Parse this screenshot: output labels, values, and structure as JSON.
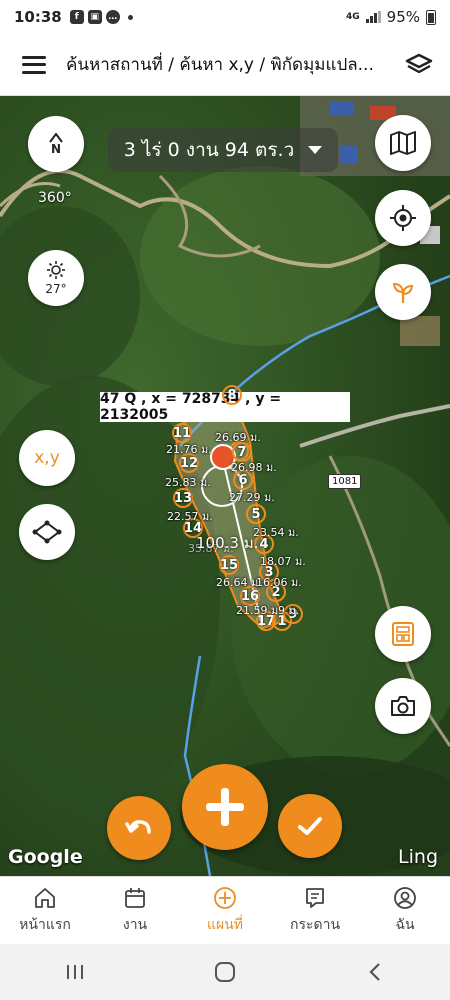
{
  "status_bar": {
    "time": "10:38",
    "network": "4G",
    "battery": "95%",
    "notification_apps": [
      "facebook-icon",
      "gallery-icon",
      "line-icon"
    ]
  },
  "header": {
    "title": "ค้นหาสถานที่ / ค้นหา x,y / พิกัดมุมแปล..."
  },
  "map": {
    "area_text": "3 ไร่ 0 งาน 94 ตร.ว",
    "compass_label": "N",
    "compass_angle": "360°",
    "temperature": "27°",
    "xy_button": "x,y",
    "coordinate": "47 Q , x = 728734 , y = 2132005",
    "road_number": "1081",
    "plot_area_label": "100.3 ม.",
    "segment_labels": [
      "21.76 ม.",
      "26.69 ม.",
      "26.98 ม.",
      "25.83 ม.",
      "27.29 ม.",
      "22.57 ม.",
      "23.54 ม.",
      "35.87 ม.",
      "18.07 ม.",
      "26.64 ม.",
      "16.06 ม.",
      "21.59 ม.",
      "9 ม."
    ],
    "vertices": [
      "1",
      "2",
      "3",
      "4",
      "5",
      "6",
      "7",
      "8",
      "9",
      "11",
      "12",
      "13",
      "14",
      "15",
      "16",
      "17"
    ],
    "attribution": "Google",
    "watermark": "Ling",
    "accent_color": "#f08b1d"
  },
  "bottom_nav": {
    "items": [
      {
        "label": "หน้าแรก",
        "icon": "home-icon"
      },
      {
        "label": "งาน",
        "icon": "calendar-icon"
      },
      {
        "label": "แผนที่",
        "icon": "plus-circle-icon"
      },
      {
        "label": "กระดาน",
        "icon": "board-icon"
      },
      {
        "label": "ฉัน",
        "icon": "user-icon"
      }
    ],
    "active": "แผนที่"
  }
}
